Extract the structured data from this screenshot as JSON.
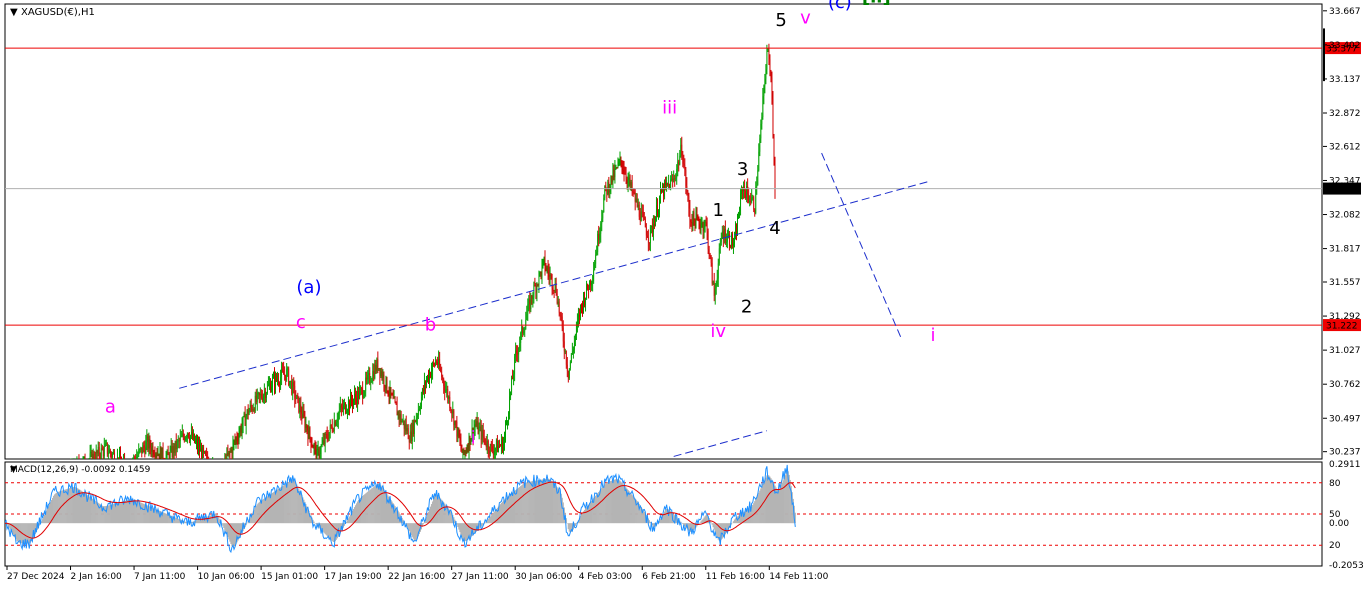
{
  "window": {
    "symbol_title": "XAGUSD(€),H1",
    "indicator_title": "MACD(12,26,9) -0.0092 0.1459"
  },
  "colors": {
    "bull": "#00a000",
    "bear": "#d00000",
    "magenta": "#ff00ff",
    "blue": "#0000ff",
    "green": "#008000",
    "black": "#000000",
    "hline": "#ee0000",
    "trend": "#1c2ecc",
    "macd_hist": "#b4b4b4",
    "macd_signal": "#e00000",
    "macd_line": "#1e90ff"
  },
  "chart_data": [
    {
      "type": "candlestick",
      "title": "XAGUSD(€),H1",
      "y_axis": {
        "ticks": [
          "33.667",
          "33.402",
          "33.137",
          "32.872",
          "32.612",
          "32.347",
          "32.082",
          "31.817",
          "31.557",
          "31.292",
          "31.027",
          "30.762",
          "30.497",
          "30.237"
        ],
        "ylim": [
          30.18,
          33.72
        ]
      },
      "x_axis": {
        "ticks": [
          "27 Dec 2024",
          "2 Jan 16:00",
          "7 Jan 11:00",
          "10 Jan 06:00",
          "15 Jan 01:00",
          "17 Jan 19:00",
          "22 Jan 16:00",
          "27 Jan 11:00",
          "30 Jan 06:00",
          "4 Feb 03:00",
          "6 Feb 21:00",
          "11 Feb 16:00",
          "14 Feb 11:00"
        ],
        "range": [
          0,
          380
        ]
      },
      "price_path": [
        [
          0,
          29.8
        ],
        [
          20,
          29.95
        ],
        [
          50,
          30.26
        ],
        [
          60,
          30.1
        ],
        [
          70,
          30.3
        ],
        [
          80,
          30.18
        ],
        [
          90,
          30.4
        ],
        [
          100,
          30.15
        ],
        [
          106,
          30.05
        ],
        [
          120,
          30.55
        ],
        [
          132,
          30.78
        ],
        [
          139,
          30.85
        ],
        [
          146,
          30.55
        ],
        [
          154,
          30.2
        ],
        [
          165,
          30.55
        ],
        [
          176,
          30.7
        ],
        [
          184,
          30.92
        ],
        [
          192,
          30.6
        ],
        [
          200,
          30.35
        ],
        [
          208,
          30.8
        ],
        [
          213,
          30.95
        ],
        [
          220,
          30.6
        ],
        [
          226,
          30.2
        ],
        [
          232,
          30.45
        ],
        [
          240,
          30.25
        ],
        [
          246,
          30.3
        ],
        [
          252,
          30.98
        ],
        [
          260,
          31.45
        ],
        [
          266,
          31.7
        ],
        [
          272,
          31.5
        ],
        [
          278,
          30.85
        ],
        [
          284,
          31.35
        ],
        [
          290,
          31.62
        ],
        [
          296,
          32.25
        ],
        [
          304,
          32.5
        ],
        [
          312,
          32.15
        ],
        [
          318,
          31.9
        ],
        [
          324,
          32.25
        ],
        [
          330,
          32.35
        ],
        [
          334,
          32.6
        ],
        [
          338,
          32.05
        ],
        [
          346,
          32.0
        ],
        [
          350,
          31.45
        ],
        [
          354,
          31.95
        ],
        [
          360,
          31.85
        ],
        [
          364,
          32.3
        ],
        [
          370,
          32.15
        ],
        [
          376,
          33.35
        ],
        [
          378,
          33.2
        ],
        [
          380,
          32.3
        ]
      ],
      "horizontal_lines": [
        {
          "price": 33.377,
          "label": "33.377"
        },
        {
          "price": 31.222,
          "label": "31.222"
        }
      ],
      "current_price": {
        "price": 32.284,
        "label": "32.284"
      },
      "trendlines": [
        {
          "from": [
            86,
            30.73
          ],
          "to": [
            456,
            32.34
          ]
        },
        {
          "from": [
            403,
            32.56
          ],
          "to": [
            442,
            31.13
          ]
        },
        {
          "from": [
            330,
            30.2
          ],
          "to": [
            376,
            30.4
          ]
        }
      ],
      "wave_labels": [
        {
          "text": "a",
          "x": 52,
          "price": 30.54,
          "color": "magenta"
        },
        {
          "text": "c",
          "x": 146,
          "price": 31.2,
          "color": "magenta"
        },
        {
          "text": "(a)",
          "x": 150,
          "price": 31.47,
          "color": "blue"
        },
        {
          "text": "b",
          "x": 210,
          "price": 31.18,
          "color": "magenta"
        },
        {
          "text": "i",
          "x": 231,
          "price": 30.3,
          "color": "magenta"
        },
        {
          "text": "iii",
          "x": 328,
          "price": 32.87,
          "color": "magenta"
        },
        {
          "text": "iv",
          "x": 352,
          "price": 31.13,
          "color": "magenta"
        },
        {
          "text": "1",
          "x": 352,
          "price": 32.07,
          "color": "black"
        },
        {
          "text": "2",
          "x": 366,
          "price": 31.32,
          "color": "black"
        },
        {
          "text": "3",
          "x": 364,
          "price": 32.39,
          "color": "black"
        },
        {
          "text": "4",
          "x": 380,
          "price": 31.93,
          "color": "black"
        },
        {
          "text": "5",
          "x": 383,
          "price": 33.55,
          "color": "black"
        },
        {
          "text": "v",
          "x": 395,
          "price": 33.57,
          "color": "magenta"
        },
        {
          "text": "(c)",
          "x": 412,
          "price": 33.69,
          "color": "blue"
        },
        {
          "text": "[ii]",
          "x": 430,
          "price": 33.73,
          "color": "green"
        },
        {
          "text": "i",
          "x": 458,
          "price": 31.1,
          "color": "magenta"
        }
      ]
    },
    {
      "type": "line",
      "title": "MACD(12,26,9) -0.0092 0.1459",
      "y_axis": {
        "ticks": [
          "0.2911",
          "80",
          "50",
          "0.00",
          "20",
          "-0.2053"
        ],
        "ylim": [
          -0.21,
          0.3
        ]
      },
      "levels": [
        80,
        50,
        20
      ],
      "series": [
        {
          "name": "MACD",
          "type": "histogram"
        },
        {
          "name": "Signal",
          "type": "line"
        }
      ],
      "macd_path": [
        [
          0,
          0.0
        ],
        [
          6,
          -0.1
        ],
        [
          12,
          -0.1
        ],
        [
          24,
          0.15
        ],
        [
          34,
          0.18
        ],
        [
          48,
          0.08
        ],
        [
          62,
          0.12
        ],
        [
          78,
          0.05
        ],
        [
          90,
          0.0
        ],
        [
          104,
          0.05
        ],
        [
          112,
          -0.13
        ],
        [
          124,
          0.1
        ],
        [
          142,
          0.22
        ],
        [
          152,
          0.0
        ],
        [
          162,
          -0.1
        ],
        [
          174,
          0.12
        ],
        [
          184,
          0.2
        ],
        [
          194,
          0.05
        ],
        [
          202,
          -0.1
        ],
        [
          212,
          0.15
        ],
        [
          220,
          0.05
        ],
        [
          226,
          -0.1
        ],
        [
          236,
          0.0
        ],
        [
          246,
          0.12
        ],
        [
          256,
          0.2
        ],
        [
          268,
          0.22
        ],
        [
          274,
          0.15
        ],
        [
          278,
          -0.07
        ],
        [
          284,
          0.05
        ],
        [
          296,
          0.2
        ],
        [
          302,
          0.22
        ],
        [
          312,
          0.1
        ],
        [
          320,
          -0.03
        ],
        [
          326,
          0.08
        ],
        [
          338,
          -0.05
        ],
        [
          346,
          0.05
        ],
        [
          352,
          -0.1
        ],
        [
          360,
          0.03
        ],
        [
          368,
          0.08
        ],
        [
          376,
          0.25
        ],
        [
          381,
          0.15
        ],
        [
          386,
          0.28
        ],
        [
          390,
          0.0
        ]
      ]
    }
  ]
}
